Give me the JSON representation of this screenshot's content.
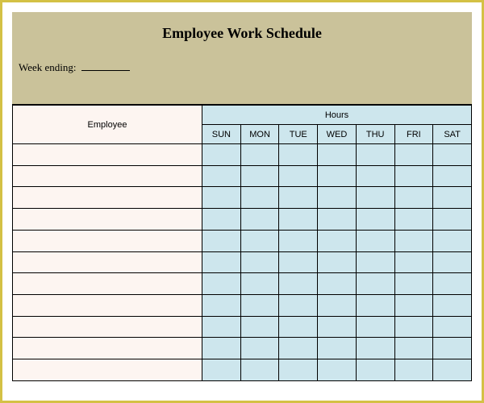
{
  "title": "Employee Work Schedule",
  "week_ending_label": "Week ending:",
  "employee_header": "Employee",
  "hours_header": "Hours",
  "days": [
    "SUN",
    "MON",
    "TUE",
    "WED",
    "THU",
    "FRI",
    "SAT"
  ],
  "rows": [
    {
      "employee": "",
      "hours": [
        "",
        "",
        "",
        "",
        "",
        "",
        ""
      ]
    },
    {
      "employee": "",
      "hours": [
        "",
        "",
        "",
        "",
        "",
        "",
        ""
      ]
    },
    {
      "employee": "",
      "hours": [
        "",
        "",
        "",
        "",
        "",
        "",
        ""
      ]
    },
    {
      "employee": "",
      "hours": [
        "",
        "",
        "",
        "",
        "",
        "",
        ""
      ]
    },
    {
      "employee": "",
      "hours": [
        "",
        "",
        "",
        "",
        "",
        "",
        ""
      ]
    },
    {
      "employee": "",
      "hours": [
        "",
        "",
        "",
        "",
        "",
        "",
        ""
      ]
    },
    {
      "employee": "",
      "hours": [
        "",
        "",
        "",
        "",
        "",
        "",
        ""
      ]
    },
    {
      "employee": "",
      "hours": [
        "",
        "",
        "",
        "",
        "",
        "",
        ""
      ]
    },
    {
      "employee": "",
      "hours": [
        "",
        "",
        "",
        "",
        "",
        "",
        ""
      ]
    },
    {
      "employee": "",
      "hours": [
        "",
        "",
        "",
        "",
        "",
        "",
        ""
      ]
    },
    {
      "employee": "",
      "hours": [
        "",
        "",
        "",
        "",
        "",
        "",
        ""
      ]
    }
  ]
}
